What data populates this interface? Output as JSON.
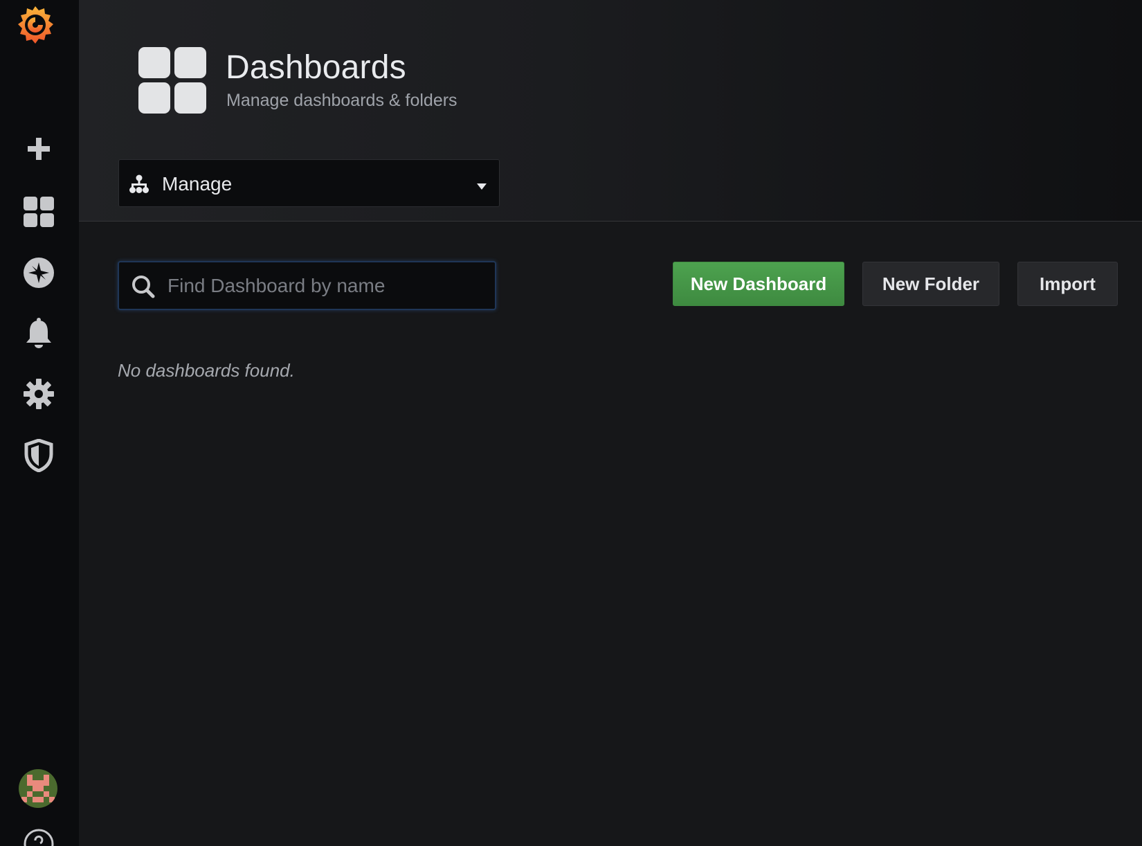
{
  "page": {
    "title": "Dashboards",
    "subtitle": "Manage dashboards & folders"
  },
  "sidebar": {
    "items": [
      {
        "name": "grafana-logo",
        "icon": "grafana-logo-icon"
      },
      {
        "name": "create",
        "icon": "plus-icon"
      },
      {
        "name": "dashboards",
        "icon": "dashboards-grid-icon"
      },
      {
        "name": "explore",
        "icon": "compass-icon"
      },
      {
        "name": "alerting",
        "icon": "bell-icon"
      },
      {
        "name": "configuration",
        "icon": "gear-icon"
      },
      {
        "name": "server-admin",
        "icon": "shield-icon"
      },
      {
        "name": "profile",
        "icon": "avatar-icon"
      },
      {
        "name": "help",
        "icon": "help-icon"
      }
    ]
  },
  "nav": {
    "selected": "Manage"
  },
  "search": {
    "placeholder": "Find Dashboard by name",
    "value": ""
  },
  "actions": {
    "new_dashboard": "New Dashboard",
    "new_folder": "New Folder",
    "import": "Import"
  },
  "results": {
    "empty_message": "No dashboards found."
  },
  "colors": {
    "background": "#161719",
    "sidebar": "#0b0c0e",
    "primary_button": "#3e8a40",
    "logo_orange": "#f47a20"
  }
}
